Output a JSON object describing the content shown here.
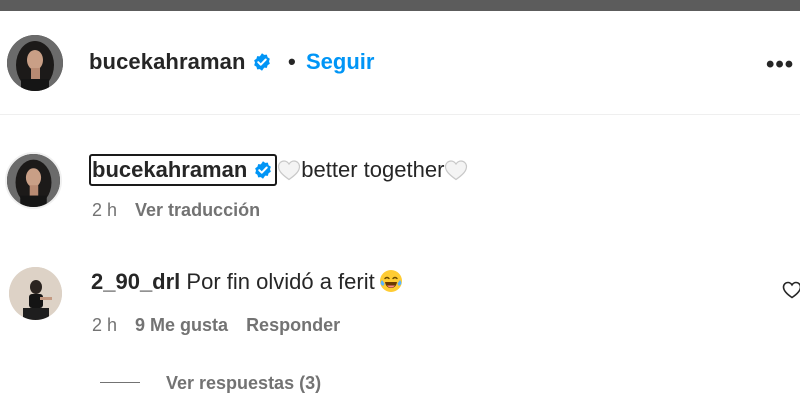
{
  "post_header": {
    "username": "bucekahraman",
    "separator": "•",
    "follow_label": "Seguir",
    "more_label": "•••"
  },
  "caption": {
    "username": "bucekahraman",
    "text": "better together",
    "time": "2 h",
    "translate_label": "Ver traducción"
  },
  "comment": {
    "username": "2_90_drl",
    "text": "Por fin olvidó a ferit",
    "time": "2 h",
    "likes_label": "9 Me gusta",
    "reply_label": "Responder"
  },
  "replies": {
    "label": "Ver respuestas (3)"
  },
  "colors": {
    "accent": "#0095f6",
    "verified": "#0095f6",
    "secondary_text": "#737373",
    "top_bar": "#5c5c5c"
  }
}
